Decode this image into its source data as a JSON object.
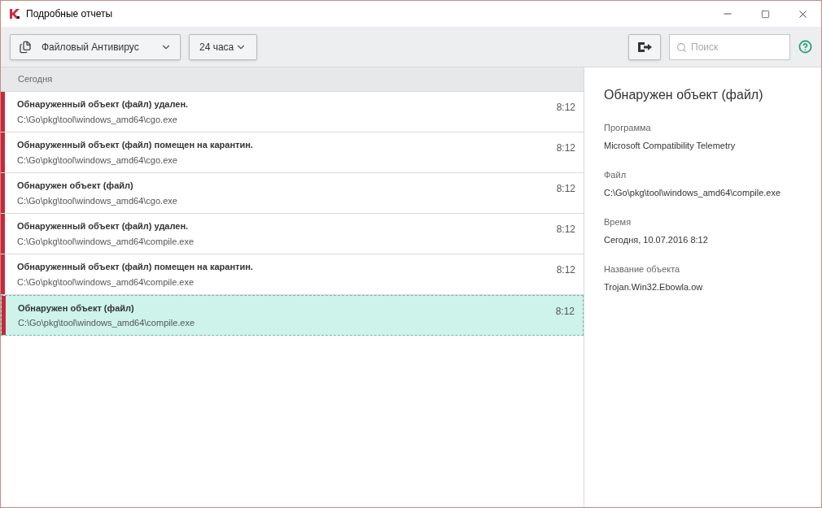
{
  "window": {
    "title": "Подробные отчеты"
  },
  "toolbar": {
    "component": "Файловый Антивирус",
    "period": "24 часа",
    "search": {
      "placeholder": "Поиск"
    }
  },
  "list": {
    "group": "Сегодня",
    "events": [
      {
        "title": "Обнаруженный объект (файл) удален.",
        "path": "C:\\Go\\pkg\\tool\\windows_amd64\\cgo.exe",
        "time": "8:12",
        "color": "#c8283c",
        "selected": false
      },
      {
        "title": "Обнаруженный объект (файл) помещен на карантин.",
        "path": "C:\\Go\\pkg\\tool\\windows_amd64\\cgo.exe",
        "time": "8:12",
        "color": "#c8283c",
        "selected": false
      },
      {
        "title": "Обнаружен объект (файл)",
        "path": "C:\\Go\\pkg\\tool\\windows_amd64\\cgo.exe",
        "time": "8:12",
        "color": "#c8283c",
        "selected": false
      },
      {
        "title": "Обнаруженный объект (файл) удален.",
        "path": "C:\\Go\\pkg\\tool\\windows_amd64\\compile.exe",
        "time": "8:12",
        "color": "#c8283c",
        "selected": false
      },
      {
        "title": "Обнаруженный объект (файл) помещен на карантин.",
        "path": "C:\\Go\\pkg\\tool\\windows_amd64\\compile.exe",
        "time": "8:12",
        "color": "#c8283c",
        "selected": false
      },
      {
        "title": "Обнаружен объект (файл)",
        "path": "C:\\Go\\pkg\\tool\\windows_amd64\\compile.exe",
        "time": "8:12",
        "color": "#c8283c",
        "selected": true
      }
    ]
  },
  "details": {
    "title": "Обнаружен объект (файл)",
    "fields": [
      {
        "label": "Программа",
        "value": "Microsoft Compatibility Telemetry"
      },
      {
        "label": "Файл",
        "value": "C:\\Go\\pkg\\tool\\windows_amd64\\compile.exe"
      },
      {
        "label": "Время",
        "value": "Сегодня, 10.07.2016 8:12"
      },
      {
        "label": "Название объекта",
        "value": "Trojan.Win32.Ebowla.ow"
      }
    ]
  }
}
